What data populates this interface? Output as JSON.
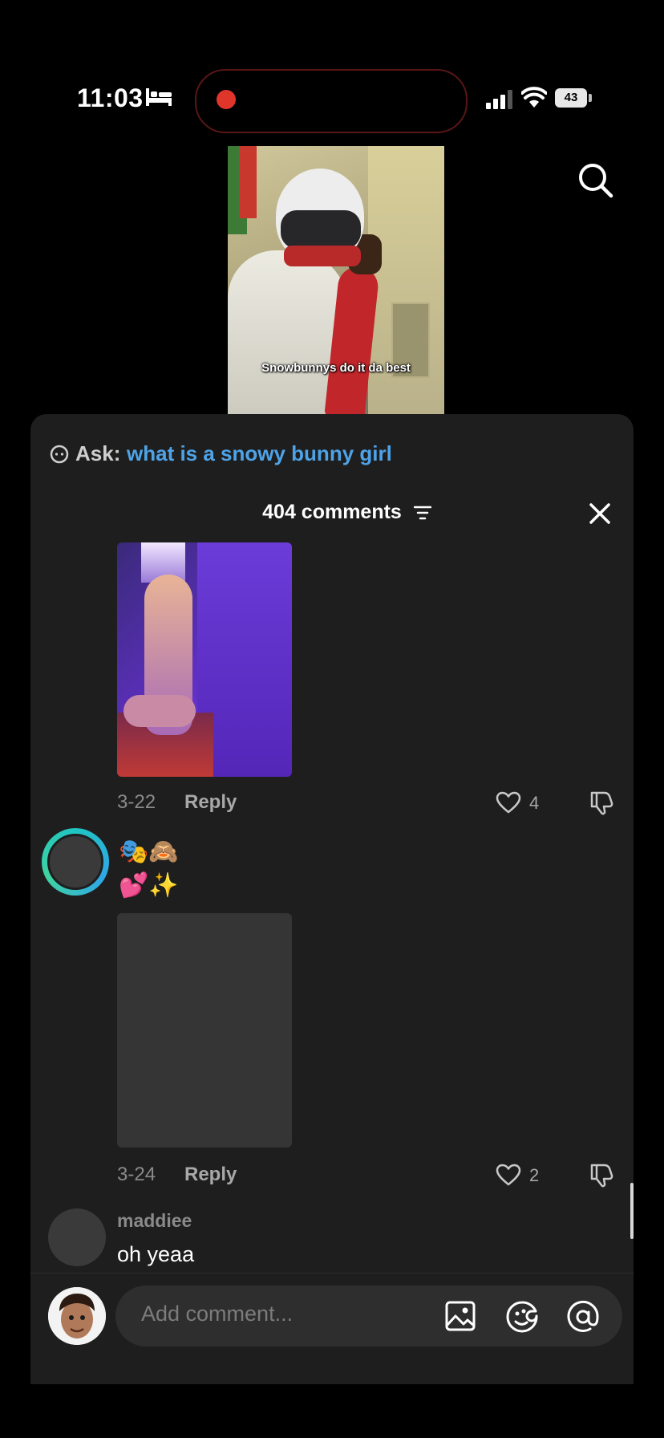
{
  "status_bar": {
    "time": "11:03",
    "battery": "43"
  },
  "video": {
    "caption": "Snowbunnys do it da best"
  },
  "ask": {
    "label": "Ask:",
    "query": "what is a snowy bunny girl"
  },
  "comments_header": {
    "title": "404 comments"
  },
  "comments": [
    {
      "date": "3-22",
      "reply": "Reply",
      "likes": "4"
    },
    {
      "emoji_line1": "🎭🙈",
      "emoji_line2": "💕✨",
      "date": "3-24",
      "reply": "Reply",
      "likes": "2"
    },
    {
      "username": "maddiee",
      "text": "oh yeaa"
    }
  ],
  "composer": {
    "placeholder": "Add comment..."
  },
  "colors": {
    "accent": "#4ea3e8",
    "sheet": "#1e1e1e",
    "record": "#e0352b",
    "story_ring": "#1fc5c1"
  },
  "icons": [
    "bed-icon",
    "record-dot-icon",
    "signal-icon",
    "wifi-icon",
    "battery-icon",
    "search-icon",
    "ask-ai-icon",
    "filter-icon",
    "close-icon",
    "heart-icon",
    "dislike-icon",
    "image-icon",
    "emoji-icon",
    "at-icon"
  ]
}
